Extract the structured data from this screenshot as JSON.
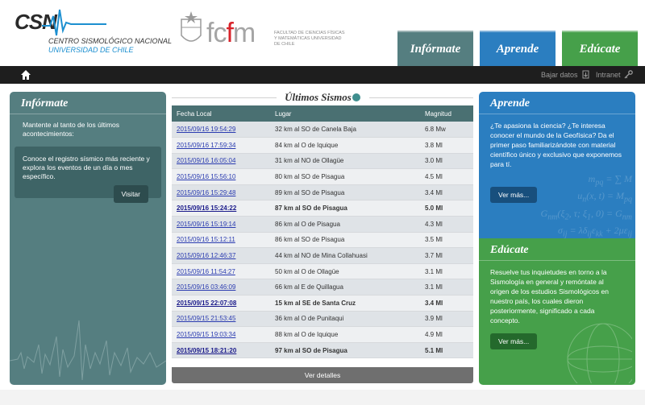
{
  "header": {
    "csn_mark": "CSN",
    "csn_name": "CENTRO SISMOLÓGICO NACIONAL",
    "csn_university": "UNIVERSIDAD DE CHILE",
    "fcfm_letters_a": "fc",
    "fcfm_letter_b": "f",
    "fcfm_letters_c": "m",
    "fcfm_faculty": "FACULTAD DE CIENCIAS FÍSICAS Y MATEMÁTICAS UNIVERSIDAD DE CHILE",
    "buttons": {
      "informate": "Infórmate",
      "aprende": "Aprende",
      "educate": "Edúcate"
    }
  },
  "nav": {
    "bajar_datos": "Bajar datos",
    "intranet": "Intranet"
  },
  "left_panel": {
    "title": "Infórmate",
    "text": "Mantente al tanto de los últimos acontecimientos:",
    "box_text": "Conoce el registro sísmico más reciente y explora los eventos de un día o mes específico.",
    "button": "Visitar"
  },
  "aprende_panel": {
    "title": "Aprende",
    "text": "¿Te apasiona la ciencia? ¿Te interesa conocer el mundo de la Geofísica? Da el primer paso familiarizándote con material científico único y exclusivo que exponemos para tí.",
    "button": "Ver más..."
  },
  "educate_panel": {
    "title": "Edúcate",
    "text": "Resuelve tus inquietudes en torno a la Sismología en general y remóntate al origen de los estudios Sismológicos en nuestro país, los cuales dieron posteriormente, significado a cada concepto.",
    "button": "Ver más..."
  },
  "sismos": {
    "title": "Últimos Sismos",
    "headers": [
      "Fecha Local",
      "Lugar",
      "Magnitud"
    ],
    "rows": [
      {
        "fecha": "2015/09/16 19:54:29",
        "lugar": "32 km al SO de Canela Baja",
        "magnitud": "6.8 Mw",
        "bold": false
      },
      {
        "fecha": "2015/09/16 17:59:34",
        "lugar": "84 km al O de Iquique",
        "magnitud": "3.8 Ml",
        "bold": false
      },
      {
        "fecha": "2015/09/16 16:05:04",
        "lugar": "31 km al NO de Ollagüe",
        "magnitud": "3.0 Ml",
        "bold": false
      },
      {
        "fecha": "2015/09/16 15:56:10",
        "lugar": "80 km al SO de Pisagua",
        "magnitud": "4.5 Ml",
        "bold": false
      },
      {
        "fecha": "2015/09/16 15:29:48",
        "lugar": "89 km al SO de Pisagua",
        "magnitud": "3.4 Ml",
        "bold": false
      },
      {
        "fecha": "2015/09/16 15:24:22",
        "lugar": "87 km al SO de Pisagua",
        "magnitud": "5.0 Ml",
        "bold": true
      },
      {
        "fecha": "2015/09/16 15:19:14",
        "lugar": "86 km al O de Pisagua",
        "magnitud": "4.3 Ml",
        "bold": false
      },
      {
        "fecha": "2015/09/16 15:12:11",
        "lugar": "86 km al SO de Pisagua",
        "magnitud": "3.5 Ml",
        "bold": false
      },
      {
        "fecha": "2015/09/16 12:46:37",
        "lugar": "44 km al NO de Mina Collahuasi",
        "magnitud": "3.7 Ml",
        "bold": false
      },
      {
        "fecha": "2015/09/16 11:54:27",
        "lugar": "50 km al O de Ollagüe",
        "magnitud": "3.1 Ml",
        "bold": false
      },
      {
        "fecha": "2015/09/16 03:46:09",
        "lugar": "66 km al E de Quillagua",
        "magnitud": "3.1 Ml",
        "bold": false
      },
      {
        "fecha": "2015/09/15 22:07:08",
        "lugar": "15 km al SE de Santa Cruz",
        "magnitud": "3.4 Ml",
        "bold": true
      },
      {
        "fecha": "2015/09/15 21:53:45",
        "lugar": "36 km al O de Punitaqui",
        "magnitud": "3.9 Ml",
        "bold": false
      },
      {
        "fecha": "2015/09/15 19:03:34",
        "lugar": "88 km al O de Iquique",
        "magnitud": "4.9 Ml",
        "bold": false
      },
      {
        "fecha": "2015/09/15 18:21:20",
        "lugar": "97 km al SO de Pisagua",
        "magnitud": "5.1 Ml",
        "bold": true
      }
    ],
    "ver_detalles": "Ver detalles"
  },
  "colors": {
    "informate": "#557e80",
    "aprende": "#2b7ec0",
    "educate": "#46a04a",
    "nav": "#1e1e1e"
  },
  "icons": [
    "home-icon",
    "download-icon",
    "key-icon",
    "seismic-wave-icon",
    "title-circle-icon"
  ]
}
